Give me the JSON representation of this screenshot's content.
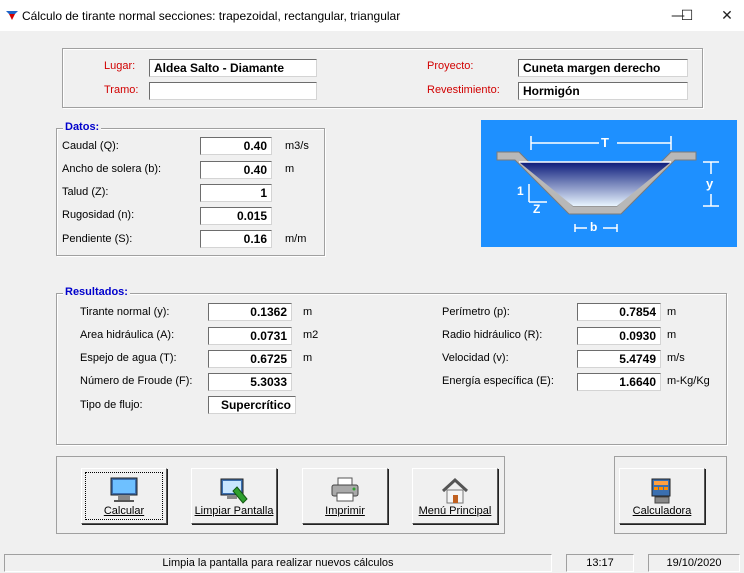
{
  "window": {
    "title": "Cálculo de tirante normal secciones: trapezoidal, rectangular, triangular",
    "minimize": "—",
    "maximize": "☐",
    "close": "✕"
  },
  "header": {
    "lugar_label": "Lugar:",
    "lugar_value": "Aldea Salto - Diamante",
    "tramo_label": "Tramo:",
    "tramo_value": "",
    "proyecto_label": "Proyecto:",
    "proyecto_value": "Cuneta margen derecho",
    "revestimiento_label": "Revestimiento:",
    "revestimiento_value": "Hormigón"
  },
  "datos": {
    "legend": "Datos:",
    "caudal": {
      "label": "Caudal (Q):",
      "value": "0.40",
      "unit": "m3/s"
    },
    "ancho": {
      "label": "Ancho de solera (b):",
      "value": "0.40",
      "unit": "m"
    },
    "talud": {
      "label": "Talud (Z):",
      "value": "1",
      "unit": ""
    },
    "rugosidad": {
      "label": "Rugosidad (n):",
      "value": "0.015",
      "unit": ""
    },
    "pendiente": {
      "label": "Pendiente (S):",
      "value": "0.16",
      "unit": "m/m"
    }
  },
  "diagram": {
    "T": "T",
    "y": "y",
    "one": "1",
    "Z": "Z",
    "b": "b"
  },
  "resultados": {
    "legend": "Resultados:",
    "tirante": {
      "label": "Tirante normal (y):",
      "value": "0.1362",
      "unit": "m"
    },
    "area": {
      "label": "Area hidráulica (A):",
      "value": "0.0731",
      "unit": "m2"
    },
    "espejo": {
      "label": "Espejo de agua (T):",
      "value": "0.6725",
      "unit": "m"
    },
    "froude": {
      "label": "Número de Froude (F):",
      "value": "5.3033",
      "unit": ""
    },
    "tipo": {
      "label": "Tipo de flujo:",
      "value": "Supercrítico"
    },
    "perimetro": {
      "label": "Perímetro (p):",
      "value": "0.7854",
      "unit": "m"
    },
    "radio": {
      "label": "Radio hidráulico (R):",
      "value": "0.0930",
      "unit": "m"
    },
    "velocidad": {
      "label": "Velocidad (v):",
      "value": "5.4749",
      "unit": "m/s"
    },
    "energia": {
      "label": "Energía específica (E):",
      "value": "1.6640",
      "unit": "m-Kg/Kg"
    }
  },
  "buttons": {
    "calcular": "Calcular",
    "limpiar": "Limpiar Pantalla",
    "imprimir": "Imprimir",
    "menu": "Menú Principal",
    "calculadora": "Calculadora"
  },
  "status": {
    "message": "Limpia la pantalla para realizar nuevos cálculos",
    "time": "13:17",
    "date": "19/10/2020"
  },
  "colors": {
    "diagram_bg": "#1e90ff",
    "label_red": "#d10000",
    "legend_blue": "#0000cc"
  }
}
